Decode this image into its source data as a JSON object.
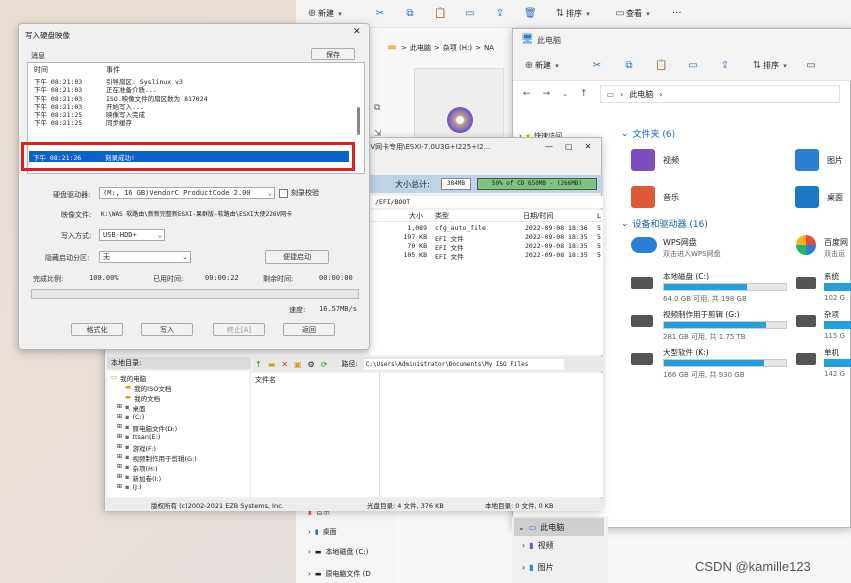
{
  "top_toolbar": {
    "new_label": "新建",
    "sort_label": "排序",
    "view_label": "查看",
    "more": "···"
  },
  "back_explorer": {
    "breadcrumb": "此电脑",
    "path1": "杂项 (H:)",
    "path2": "NA",
    "crumb_arrow": ">"
  },
  "front_explorer": {
    "title": "此电脑",
    "new_label": "新建",
    "sort_label": "排序",
    "address": "此电脑",
    "quick_access": "快速访问",
    "folders_header": "文件夹 (6)",
    "folders": [
      {
        "name": "视频",
        "icon": "video-folder-icon",
        "color": "#7a4fc4"
      },
      {
        "name": "图片",
        "icon": "pictures-folder-icon",
        "color": "#2a7fd4"
      },
      {
        "name": "音乐",
        "icon": "music-folder-icon",
        "color": "#e0583a"
      },
      {
        "name": "桌面",
        "icon": "desktop-folder-icon",
        "color": "#1a78c8"
      }
    ],
    "drives_header": "设备和驱动器 (16)",
    "wps": {
      "name": "WPS网盘",
      "sub": "双击进入WPS网盘"
    },
    "baidu": {
      "name": "百度网",
      "sub": "双击运"
    },
    "drives": [
      {
        "name": "本地磁盘 (C:)",
        "free": "64.0 GB 可用, 共 198 GB",
        "fill": 0.68
      },
      {
        "name": "视频制作用于剪辑 (G:)",
        "free": "281 GB 可用, 共 1.75 TB",
        "fill": 0.84
      },
      {
        "name": "大型软件 (K:)",
        "free": "166 GB 可用, 共 930 GB",
        "fill": 0.82
      }
    ],
    "drives_right": [
      {
        "name": "系统",
        "free": "102 G"
      },
      {
        "name": "杂项",
        "free": "115 G"
      },
      {
        "name": "单机",
        "free": "142 G"
      }
    ]
  },
  "bottom_nav": {
    "items": [
      "此电脑",
      "视频",
      "图片"
    ],
    "selected": "此电脑"
  },
  "left_bottom_nav": {
    "items": [
      "桌面",
      "本地磁盘 (C:)",
      "原电脑文件 (D"
    ],
    "top_item": "音乐"
  },
  "ultraiso": {
    "menu_title": "226V网卡专用\\ESXI-7.0U3G+I225+I2...",
    "size_label": "大小总计:",
    "size_value": "384MB",
    "capacity_bar": "50% of CD 650MB - (266MB)",
    "path": "/EFI/BOOT",
    "columns": [
      "大小",
      "类型",
      "日期/时间",
      "L"
    ],
    "files": [
      {
        "size": "1,089",
        "type": "cfg_auto_file",
        "date": "2022-09-08 18:36",
        "l": "5"
      },
      {
        "size": "197 KB",
        "type": "EFI 文件",
        "date": "2022-09-08 18:35",
        "l": "5"
      },
      {
        "size": "70 KB",
        "type": "EFI 文件",
        "date": "2022-09-08 18:35",
        "l": "5"
      },
      {
        "size": "105 KB",
        "type": "EFI 文件",
        "date": "2022-09-08 18:35",
        "l": "5"
      }
    ],
    "local_header": "本地目录:",
    "local_path_label": "路径:",
    "local_path": "C:\\Users\\Administrator\\Documents\\My ISO Files",
    "local_col": "文件名",
    "tree": [
      "我的电脑",
      "我的ISO文档",
      "我的文档",
      "桌面",
      "(C:)",
      "原电脑文件(D:)",
      "ttsan(E:)",
      "游戏(F:)",
      "视频制作用于剪辑(G:)",
      "杂项(H:)",
      "新加卷(I:)",
      "(J:)"
    ],
    "status_left": "版权所有 (c)2002-2021 EZB Systems, Inc.",
    "status_mid": "光盘目录: 4 文件, 376 KB",
    "status_right": "本地目录: 0 文件, 0 KB"
  },
  "dialog": {
    "title": "写入硬盘映像",
    "msg_label": "消息",
    "save_btn": "保存",
    "log_header_time": "时间",
    "log_header_event": "事件",
    "log": [
      {
        "time": "下午 08:21:03",
        "event": "引导扇区: Syslinux v3"
      },
      {
        "time": "下午 08:21:03",
        "event": "正在准备介质..."
      },
      {
        "time": "下午 08:21:03",
        "event": "ISO 映像文件的扇区数为 817024"
      },
      {
        "time": "下午 08:21:03",
        "event": "开始写入..."
      },
      {
        "time": "下午 08:21:25",
        "event": "映像写入完成"
      },
      {
        "time": "下午 08:21:25",
        "event": "同步缓存"
      }
    ],
    "highlight": {
      "time": "下午 08:21:26",
      "event": "刻录成功!"
    },
    "drive_label": "硬盘驱动器:",
    "drive_value": "(M:, 16 GB)VendorC ProductCode    2.00",
    "verify_label": "刻录校验",
    "image_label": "映像文件:",
    "image_value": "K:\\WAS 软路由\\新新完整新ESXI-果群版-软路由\\ESXI大使226V网卡",
    "method_label": "写入方式:",
    "method_value": "USB-HDD+",
    "hide_label": "隐藏启动分区:",
    "hide_value": "无",
    "boot_btn": "便捷启动",
    "done_label": "完成比例:",
    "done_value": "100.00%",
    "used_label": "已用时间:",
    "used_value": "00:00:22",
    "remain_label": "剩余时间:",
    "remain_value": "00:00:00",
    "progress": 1.0,
    "speed_label": "速度:",
    "speed_value": "16.57MB/s",
    "buttons": [
      "格式化",
      "写入",
      "终止[A]",
      "返回"
    ],
    "highlight_color": "#e0201e",
    "selection_color": "#0a63c9"
  },
  "watermark": "CSDN @kamille123"
}
